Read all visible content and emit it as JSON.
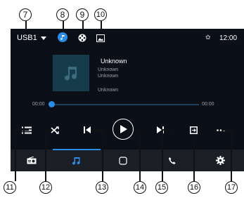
{
  "callouts": [
    "7",
    "8",
    "9",
    "10",
    "11",
    "12",
    "13",
    "14",
    "15",
    "16",
    "17"
  ],
  "status_bar": {
    "source_label": "USB1",
    "time": "12:00"
  },
  "now_playing": {
    "title": "Unknown",
    "artist": "Unknown",
    "album": "Unknown",
    "extra": "Unknown"
  },
  "progress": {
    "elapsed": "00:00",
    "total": "00:00",
    "fraction": 0
  },
  "controls": [
    "playlist-icon",
    "shuffle-icon",
    "previous-icon",
    "play-icon",
    "next-icon",
    "repeat-icon",
    "more-icon"
  ],
  "dock": [
    "radio-icon",
    "music-icon",
    "home-icon",
    "phone-icon",
    "settings-icon"
  ],
  "colors": {
    "screen_bg": "#0b0f17",
    "accent": "#2d8de6",
    "dock_bg": "#1b1f25",
    "art_bg": "#163c4b"
  }
}
